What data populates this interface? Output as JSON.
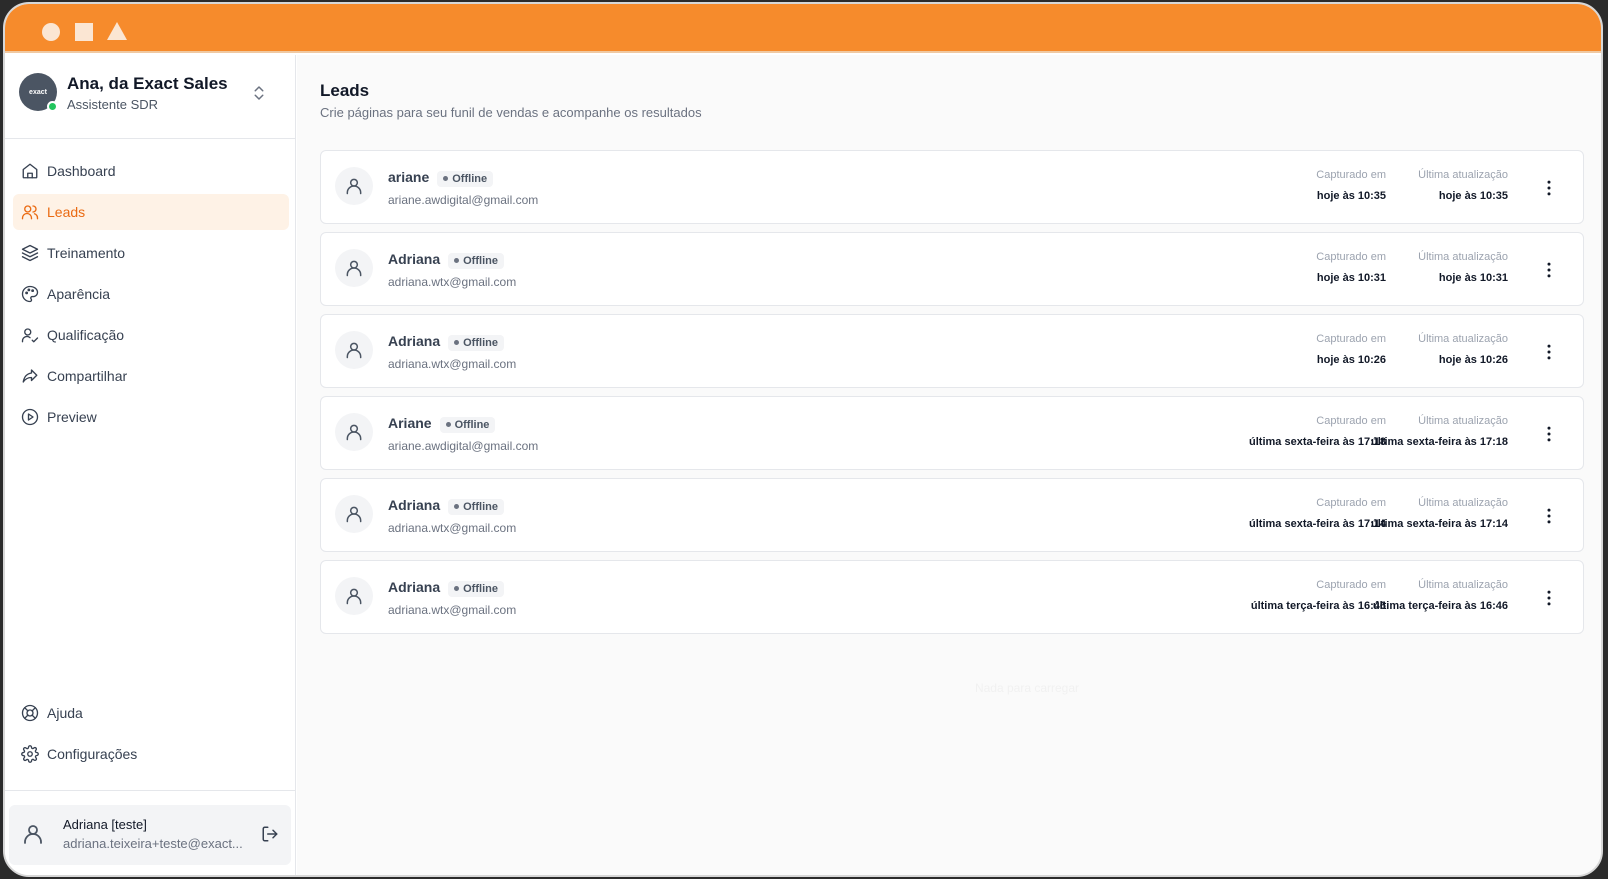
{
  "window": {
    "titlebar_color": "#f68b2c"
  },
  "sidebar": {
    "org": {
      "name": "Ana, da Exact Sales",
      "role": "Assistente SDR",
      "logo_text": "exact"
    },
    "items": [
      {
        "label": "Dashboard",
        "icon": "home-icon"
      },
      {
        "label": "Leads",
        "icon": "users-icon",
        "active": true
      },
      {
        "label": "Treinamento",
        "icon": "layers-icon"
      },
      {
        "label": "Aparência",
        "icon": "palette-icon"
      },
      {
        "label": "Qualificação",
        "icon": "user-check-icon"
      },
      {
        "label": "Compartilhar",
        "icon": "share-icon"
      },
      {
        "label": "Preview",
        "icon": "play-circle-icon"
      }
    ],
    "bottom_items": [
      {
        "label": "Ajuda",
        "icon": "lifebuoy-icon"
      },
      {
        "label": "Configurações",
        "icon": "gear-icon"
      }
    ],
    "user": {
      "name": "Adriana [teste]",
      "email": "adriana.teixeira+teste@exact..."
    }
  },
  "main": {
    "title": "Leads",
    "subtitle": "Crie páginas para seu funil de vendas e acompanhe os resultados",
    "col_captured_label": "Capturado em",
    "col_updated_label": "Última atualização",
    "leads": [
      {
        "name": "ariane",
        "status": "Offline",
        "email": "ariane.awdigital@gmail.com",
        "captured": "hoje às 10:35",
        "updated": "hoje às 10:35"
      },
      {
        "name": "Adriana",
        "status": "Offline",
        "email": "adriana.wtx@gmail.com",
        "captured": "hoje às 10:31",
        "updated": "hoje às 10:31"
      },
      {
        "name": "Adriana",
        "status": "Offline",
        "email": "adriana.wtx@gmail.com",
        "captured": "hoje às 10:26",
        "updated": "hoje às 10:26"
      },
      {
        "name": "Ariane",
        "status": "Offline",
        "email": "ariane.awdigital@gmail.com",
        "captured": "última sexta-feira às 17:18",
        "updated": "última sexta-feira às 17:18"
      },
      {
        "name": "Adriana",
        "status": "Offline",
        "email": "adriana.wtx@gmail.com",
        "captured": "última sexta-feira às 17:14",
        "updated": "última sexta-feira às 17:14"
      },
      {
        "name": "Adriana",
        "status": "Offline",
        "email": "adriana.wtx@gmail.com",
        "captured": "última terça-feira às 16:46",
        "updated": "última terça-feira às 16:46"
      }
    ],
    "empty_text": "Nada para carregar"
  }
}
